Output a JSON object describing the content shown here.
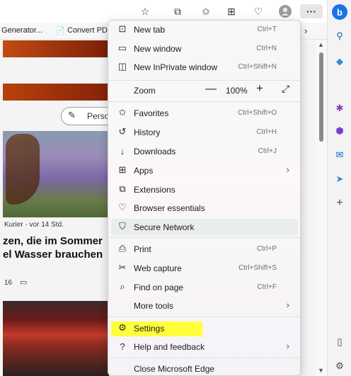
{
  "toolbar": {
    "icons": [
      "favorite-star-icon",
      "extensions-icon",
      "favorites-icon",
      "collections-icon",
      "browser-essentials-icon",
      "profile-avatar-icon",
      "more-options-icon"
    ],
    "more_label": "···"
  },
  "favorites_bar": {
    "items": [
      "Generator...",
      "Convert PDF"
    ]
  },
  "sidebar": {
    "icons": [
      "bing-copilot-icon",
      "search-icon",
      "shopping-tag-icon",
      "tools-icon",
      "games-icon",
      "outlook-icon",
      "send-icon",
      "add-icon",
      "sidebar-toggle-icon",
      "settings-gear-icon"
    ],
    "bing_letter": "b"
  },
  "page": {
    "persona_label": "Person",
    "source_text": "Kurier · vor 14 Std.",
    "headline": "zen, die im Sommer\nel Wasser brauchen",
    "likes": "16",
    "more_link": "k"
  },
  "menu": {
    "items": [
      {
        "label": "New tab",
        "shortcut": "Ctrl+T",
        "icon": "new-tab-icon"
      },
      {
        "label": "New window",
        "shortcut": "Ctrl+N",
        "icon": "new-window-icon"
      },
      {
        "label": "New InPrivate window",
        "shortcut": "Ctrl+Shift+N",
        "icon": "inprivate-icon"
      },
      {
        "label": "Favorites",
        "shortcut": "Ctrl+Shift+O",
        "icon": "favorites-icon"
      },
      {
        "label": "History",
        "shortcut": "Ctrl+H",
        "icon": "history-icon"
      },
      {
        "label": "Downloads",
        "shortcut": "Ctrl+J",
        "icon": "downloads-icon"
      },
      {
        "label": "Apps",
        "shortcut": "",
        "icon": "apps-icon"
      },
      {
        "label": "Extensions",
        "shortcut": "",
        "icon": "extensions-icon"
      },
      {
        "label": "Browser essentials",
        "shortcut": "",
        "icon": "heart-pulse-icon"
      },
      {
        "label": "Secure Network",
        "shortcut": "",
        "icon": "shield-icon"
      },
      {
        "label": "Print",
        "shortcut": "Ctrl+P",
        "icon": "print-icon"
      },
      {
        "label": "Web capture",
        "shortcut": "Ctrl+Shift+S",
        "icon": "web-capture-icon"
      },
      {
        "label": "Find on page",
        "shortcut": "Ctrl+F",
        "icon": "find-icon"
      },
      {
        "label": "More tools",
        "shortcut": "",
        "icon": ""
      },
      {
        "label": "Settings",
        "shortcut": "",
        "icon": "settings-gear-icon"
      },
      {
        "label": "Help and feedback",
        "shortcut": "",
        "icon": "help-icon"
      },
      {
        "label": "Close Microsoft Edge",
        "shortcut": "",
        "icon": ""
      }
    ],
    "zoom": {
      "label": "Zoom",
      "value": "100%",
      "minus": "—",
      "plus": "+"
    }
  },
  "colors": {
    "highlight": "#ffff3c",
    "bing": "#1a73e8",
    "secure_network_bg": "#eaeeea"
  }
}
